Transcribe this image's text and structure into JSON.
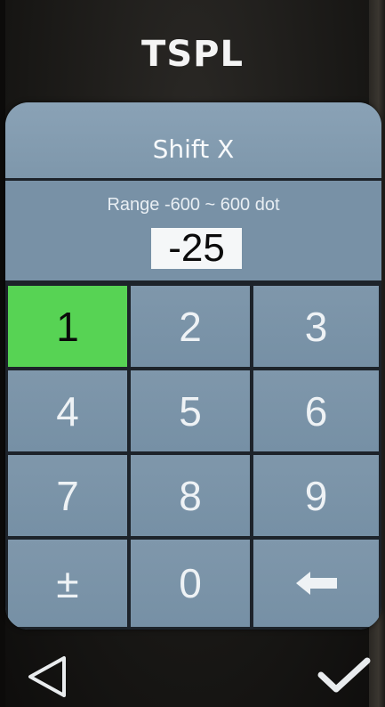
{
  "header": {
    "title": "TSPL"
  },
  "dialog": {
    "title": "Shift X",
    "range_text": "Range -600 ~ 600 dot",
    "value": "-25"
  },
  "keypad": {
    "keys": [
      "1",
      "2",
      "3",
      "4",
      "5",
      "6",
      "7",
      "8",
      "9",
      "±",
      "0",
      "backspace-icon"
    ],
    "active_key": "1"
  },
  "nav": {
    "back_icon": "back-triangle-icon",
    "confirm_icon": "checkmark-icon"
  },
  "colors": {
    "active_key": "#57d354",
    "key": "#7891a6",
    "divider": "#1d232a"
  }
}
